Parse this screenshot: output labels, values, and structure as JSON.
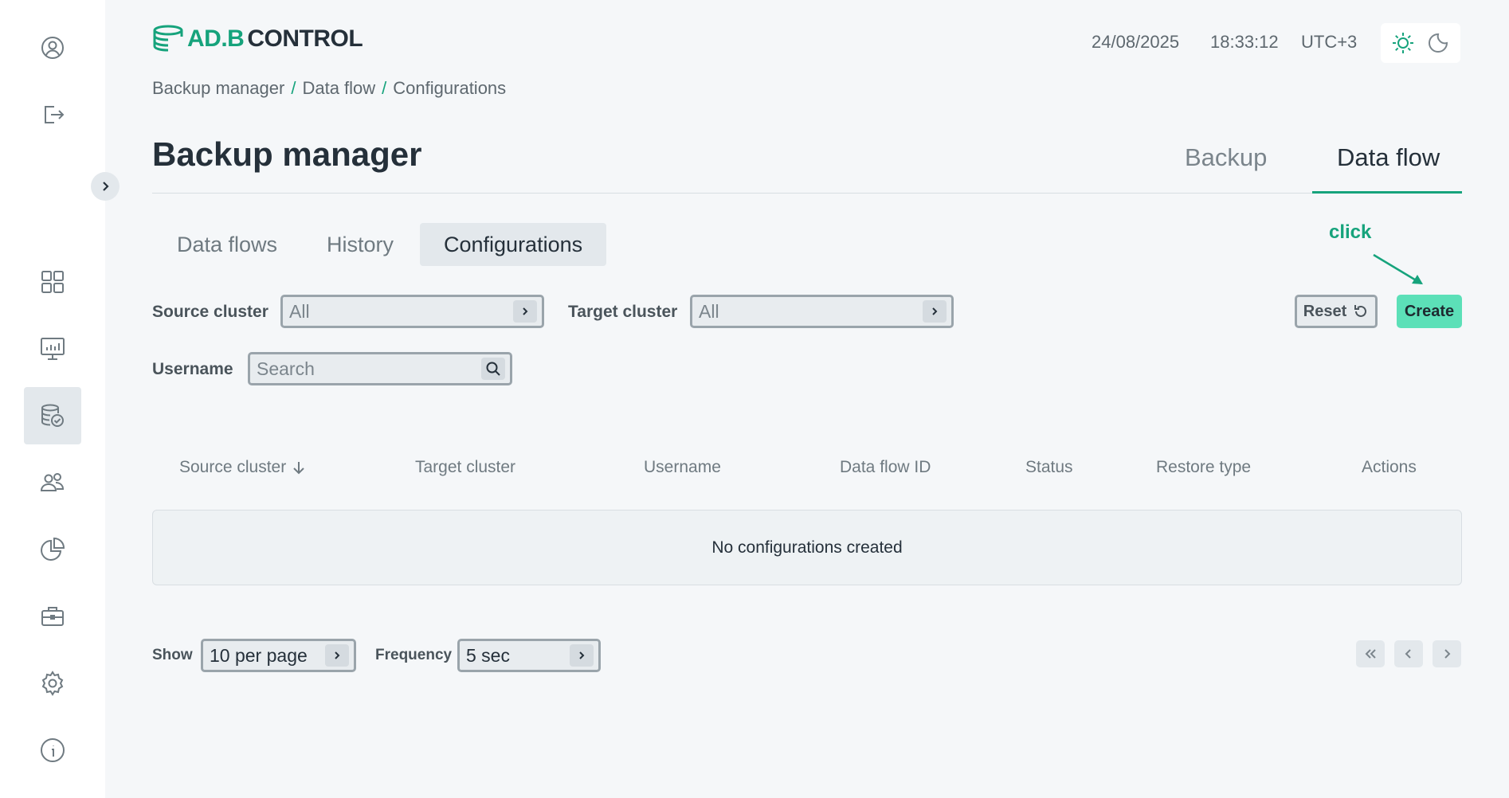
{
  "app": {
    "logo_primary": "AD.B",
    "logo_secondary": "CONTROL"
  },
  "header": {
    "date": "24/08/2025",
    "time": "18:33:12",
    "timezone": "UTC+3"
  },
  "theme": {
    "light_icon": "sun-icon",
    "dark_icon": "moon-icon"
  },
  "sidebar": {
    "items": [
      {
        "name": "profile",
        "icon": "user-icon"
      },
      {
        "name": "logout",
        "icon": "logout-icon"
      },
      {
        "name": "dashboard",
        "icon": "grid-icon"
      },
      {
        "name": "monitoring",
        "icon": "monitor-chart-icon"
      },
      {
        "name": "backup-manager",
        "icon": "database-check-icon",
        "active": true
      },
      {
        "name": "users",
        "icon": "users-icon"
      },
      {
        "name": "reports",
        "icon": "pie-chart-icon"
      },
      {
        "name": "tools",
        "icon": "briefcase-icon"
      },
      {
        "name": "settings",
        "icon": "gear-icon"
      },
      {
        "name": "info",
        "icon": "info-icon"
      }
    ]
  },
  "breadcrumb": [
    "Backup manager",
    "Data flow",
    "Configurations"
  ],
  "page": {
    "title": "Backup manager"
  },
  "main_tabs": [
    {
      "label": "Backup",
      "active": false
    },
    {
      "label": "Data flow",
      "active": true
    }
  ],
  "sub_tabs": [
    {
      "label": "Data flows"
    },
    {
      "label": "History"
    },
    {
      "label": "Configurations",
      "active": true
    }
  ],
  "filters": {
    "source_cluster": {
      "label": "Source cluster",
      "value": "All"
    },
    "target_cluster": {
      "label": "Target cluster",
      "value": "All"
    },
    "username": {
      "label": "Username",
      "placeholder": "Search"
    }
  },
  "annotation": "click",
  "actions": {
    "reset_label": "Reset",
    "create_label": "Create"
  },
  "table": {
    "columns": [
      "Source cluster",
      "Target cluster",
      "Username",
      "Data flow ID",
      "Status",
      "Restore type",
      "Actions"
    ],
    "empty_text": "No configurations created"
  },
  "footer": {
    "show_label": "Show",
    "page_size": "10 per page",
    "frequency_label": "Frequency",
    "frequency": "5 sec"
  },
  "colors": {
    "accent": "#16a37c",
    "create_button": "#5ce0b8"
  }
}
